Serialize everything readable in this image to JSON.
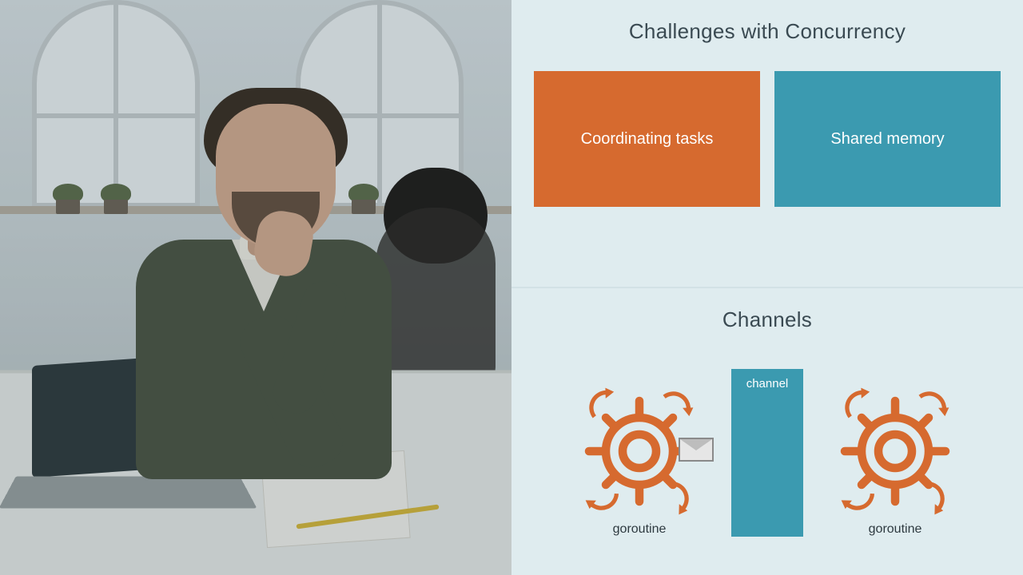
{
  "slides": {
    "top": {
      "title": "Challenges with Concurrency",
      "cards": [
        {
          "label": "Coordinating tasks",
          "color": "orange"
        },
        {
          "label": "Shared memory",
          "color": "teal"
        }
      ]
    },
    "bottom": {
      "title": "Channels",
      "left_label": "goroutine",
      "channel_label": "channel",
      "right_label": "goroutine"
    }
  },
  "colors": {
    "orange": "#d66a2f",
    "teal": "#3b9ab0",
    "slide_bg": "#dfecef"
  }
}
